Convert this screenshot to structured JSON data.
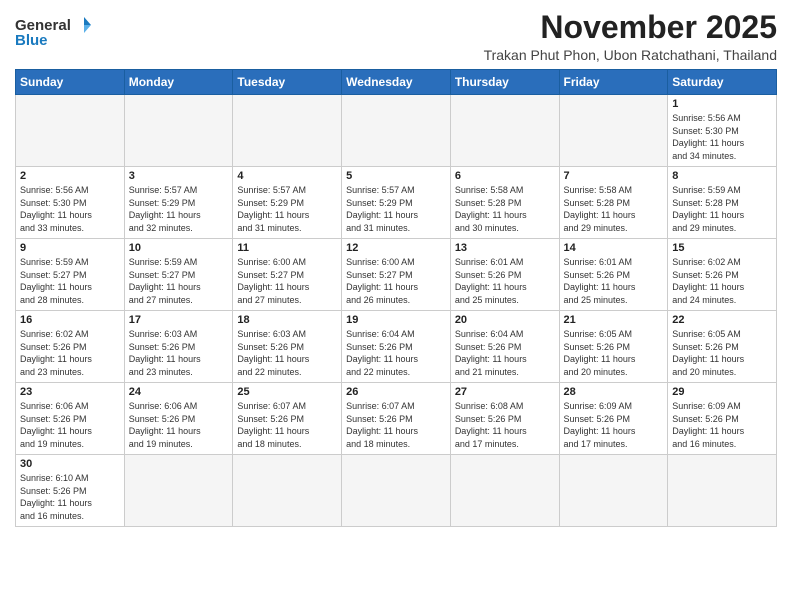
{
  "header": {
    "logo_general": "General",
    "logo_blue": "Blue",
    "month_title": "November 2025",
    "location": "Trakan Phut Phon, Ubon Ratchathani, Thailand"
  },
  "weekdays": [
    "Sunday",
    "Monday",
    "Tuesday",
    "Wednesday",
    "Thursday",
    "Friday",
    "Saturday"
  ],
  "rows": [
    [
      {
        "day": "",
        "info": ""
      },
      {
        "day": "",
        "info": ""
      },
      {
        "day": "",
        "info": ""
      },
      {
        "day": "",
        "info": ""
      },
      {
        "day": "",
        "info": ""
      },
      {
        "day": "",
        "info": ""
      },
      {
        "day": "1",
        "info": "Sunrise: 5:56 AM\nSunset: 5:30 PM\nDaylight: 11 hours\nand 34 minutes."
      }
    ],
    [
      {
        "day": "2",
        "info": "Sunrise: 5:56 AM\nSunset: 5:30 PM\nDaylight: 11 hours\nand 33 minutes."
      },
      {
        "day": "3",
        "info": "Sunrise: 5:57 AM\nSunset: 5:29 PM\nDaylight: 11 hours\nand 32 minutes."
      },
      {
        "day": "4",
        "info": "Sunrise: 5:57 AM\nSunset: 5:29 PM\nDaylight: 11 hours\nand 31 minutes."
      },
      {
        "day": "5",
        "info": "Sunrise: 5:57 AM\nSunset: 5:29 PM\nDaylight: 11 hours\nand 31 minutes."
      },
      {
        "day": "6",
        "info": "Sunrise: 5:58 AM\nSunset: 5:28 PM\nDaylight: 11 hours\nand 30 minutes."
      },
      {
        "day": "7",
        "info": "Sunrise: 5:58 AM\nSunset: 5:28 PM\nDaylight: 11 hours\nand 29 minutes."
      },
      {
        "day": "8",
        "info": "Sunrise: 5:59 AM\nSunset: 5:28 PM\nDaylight: 11 hours\nand 29 minutes."
      }
    ],
    [
      {
        "day": "9",
        "info": "Sunrise: 5:59 AM\nSunset: 5:27 PM\nDaylight: 11 hours\nand 28 minutes."
      },
      {
        "day": "10",
        "info": "Sunrise: 5:59 AM\nSunset: 5:27 PM\nDaylight: 11 hours\nand 27 minutes."
      },
      {
        "day": "11",
        "info": "Sunrise: 6:00 AM\nSunset: 5:27 PM\nDaylight: 11 hours\nand 27 minutes."
      },
      {
        "day": "12",
        "info": "Sunrise: 6:00 AM\nSunset: 5:27 PM\nDaylight: 11 hours\nand 26 minutes."
      },
      {
        "day": "13",
        "info": "Sunrise: 6:01 AM\nSunset: 5:26 PM\nDaylight: 11 hours\nand 25 minutes."
      },
      {
        "day": "14",
        "info": "Sunrise: 6:01 AM\nSunset: 5:26 PM\nDaylight: 11 hours\nand 25 minutes."
      },
      {
        "day": "15",
        "info": "Sunrise: 6:02 AM\nSunset: 5:26 PM\nDaylight: 11 hours\nand 24 minutes."
      }
    ],
    [
      {
        "day": "16",
        "info": "Sunrise: 6:02 AM\nSunset: 5:26 PM\nDaylight: 11 hours\nand 23 minutes."
      },
      {
        "day": "17",
        "info": "Sunrise: 6:03 AM\nSunset: 5:26 PM\nDaylight: 11 hours\nand 23 minutes."
      },
      {
        "day": "18",
        "info": "Sunrise: 6:03 AM\nSunset: 5:26 PM\nDaylight: 11 hours\nand 22 minutes."
      },
      {
        "day": "19",
        "info": "Sunrise: 6:04 AM\nSunset: 5:26 PM\nDaylight: 11 hours\nand 22 minutes."
      },
      {
        "day": "20",
        "info": "Sunrise: 6:04 AM\nSunset: 5:26 PM\nDaylight: 11 hours\nand 21 minutes."
      },
      {
        "day": "21",
        "info": "Sunrise: 6:05 AM\nSunset: 5:26 PM\nDaylight: 11 hours\nand 20 minutes."
      },
      {
        "day": "22",
        "info": "Sunrise: 6:05 AM\nSunset: 5:26 PM\nDaylight: 11 hours\nand 20 minutes."
      }
    ],
    [
      {
        "day": "23",
        "info": "Sunrise: 6:06 AM\nSunset: 5:26 PM\nDaylight: 11 hours\nand 19 minutes."
      },
      {
        "day": "24",
        "info": "Sunrise: 6:06 AM\nSunset: 5:26 PM\nDaylight: 11 hours\nand 19 minutes."
      },
      {
        "day": "25",
        "info": "Sunrise: 6:07 AM\nSunset: 5:26 PM\nDaylight: 11 hours\nand 18 minutes."
      },
      {
        "day": "26",
        "info": "Sunrise: 6:07 AM\nSunset: 5:26 PM\nDaylight: 11 hours\nand 18 minutes."
      },
      {
        "day": "27",
        "info": "Sunrise: 6:08 AM\nSunset: 5:26 PM\nDaylight: 11 hours\nand 17 minutes."
      },
      {
        "day": "28",
        "info": "Sunrise: 6:09 AM\nSunset: 5:26 PM\nDaylight: 11 hours\nand 17 minutes."
      },
      {
        "day": "29",
        "info": "Sunrise: 6:09 AM\nSunset: 5:26 PM\nDaylight: 11 hours\nand 16 minutes."
      }
    ],
    [
      {
        "day": "30",
        "info": "Sunrise: 6:10 AM\nSunset: 5:26 PM\nDaylight: 11 hours\nand 16 minutes."
      },
      {
        "day": "",
        "info": ""
      },
      {
        "day": "",
        "info": ""
      },
      {
        "day": "",
        "info": ""
      },
      {
        "day": "",
        "info": ""
      },
      {
        "day": "",
        "info": ""
      },
      {
        "day": "",
        "info": ""
      }
    ]
  ]
}
